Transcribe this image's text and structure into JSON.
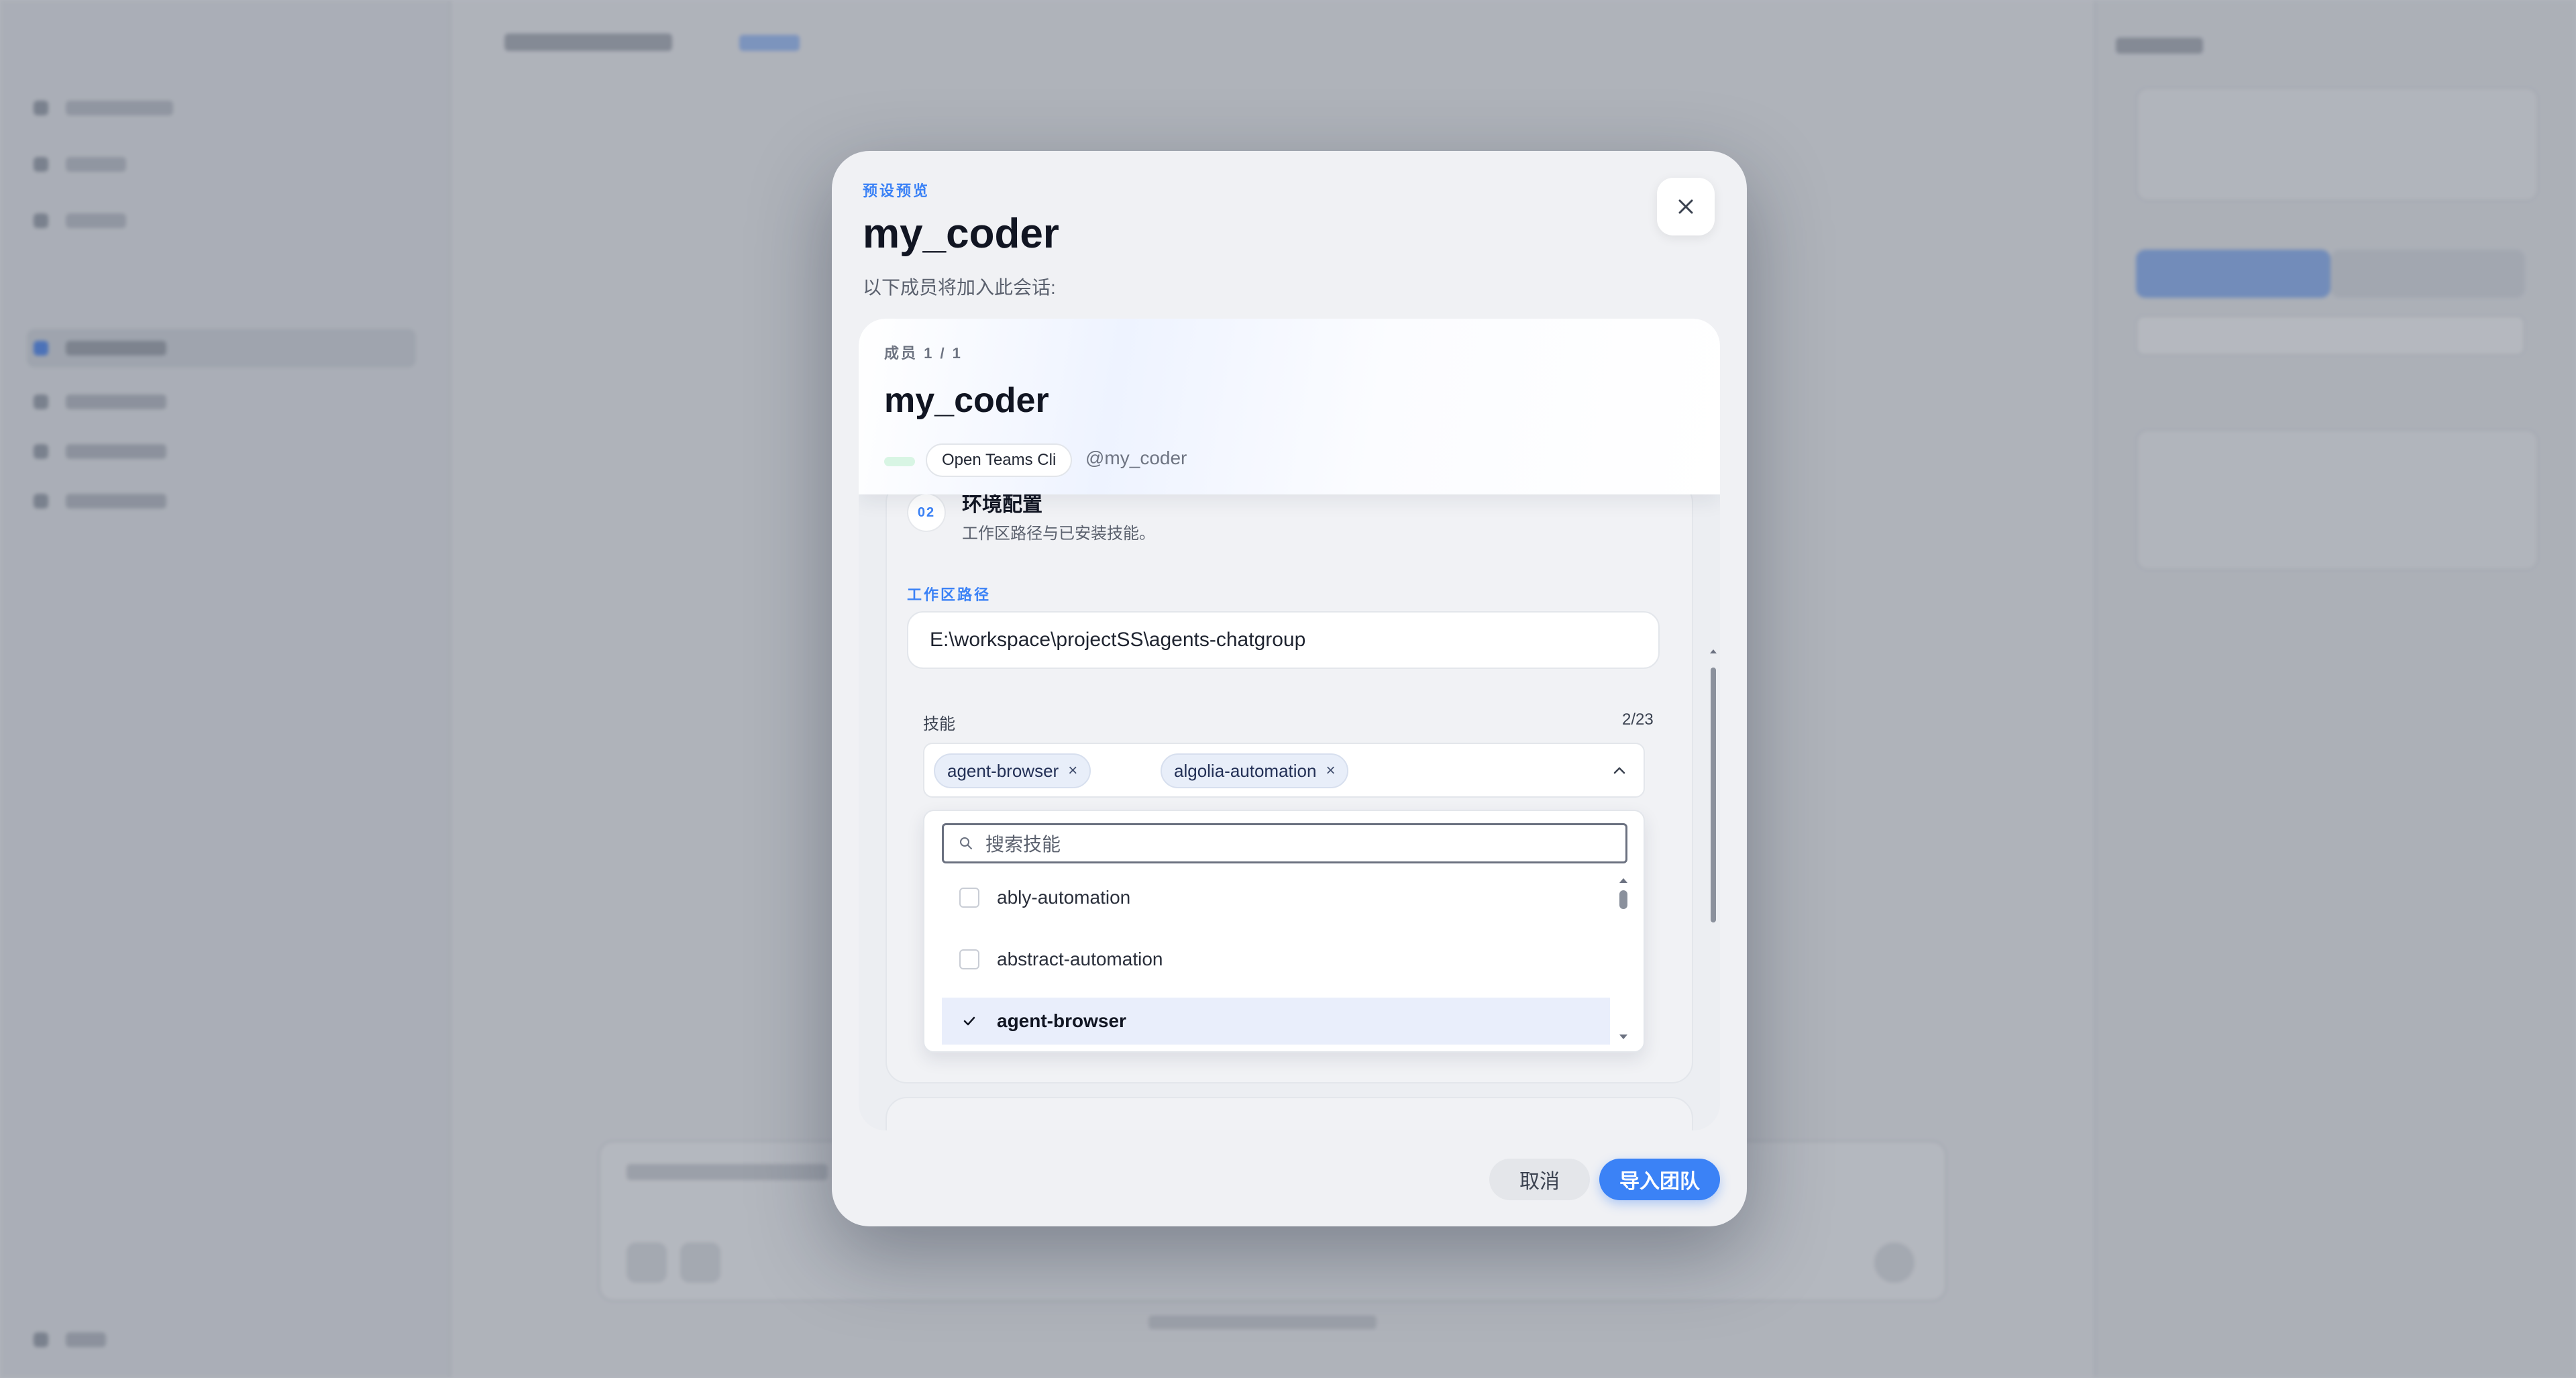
{
  "modal": {
    "eyebrow": "预设预览",
    "title": "my_coder",
    "subtitle": "以下成员将加入此会话:",
    "close_icon": "close-icon"
  },
  "member": {
    "count_label": "成员 1 / 1",
    "name": "my_coder",
    "type_badge": "Open Teams Cli",
    "handle": "@my_coder"
  },
  "env_section": {
    "step": "02",
    "title": "环境配置",
    "description": "工作区路径与已安装技能。",
    "workspace_label": "工作区路径",
    "workspace_value": "E:\\workspace\\projectSS\\agents-chatgroup"
  },
  "skills": {
    "label": "技能",
    "count": "2/23",
    "selected": [
      {
        "label": "agent-browser"
      },
      {
        "label": "algolia-automation"
      }
    ],
    "search_placeholder": "搜索技能",
    "options": [
      {
        "label": "ably-automation",
        "checked": false
      },
      {
        "label": "abstract-automation",
        "checked": false
      },
      {
        "label": "agent-browser",
        "checked": true
      }
    ]
  },
  "footer": {
    "cancel_label": "取消",
    "import_label": "导入团队"
  },
  "colors": {
    "accent": "#3b82f6",
    "chip_bg": "#e8eef9",
    "selected_row": "#e9eefb"
  }
}
